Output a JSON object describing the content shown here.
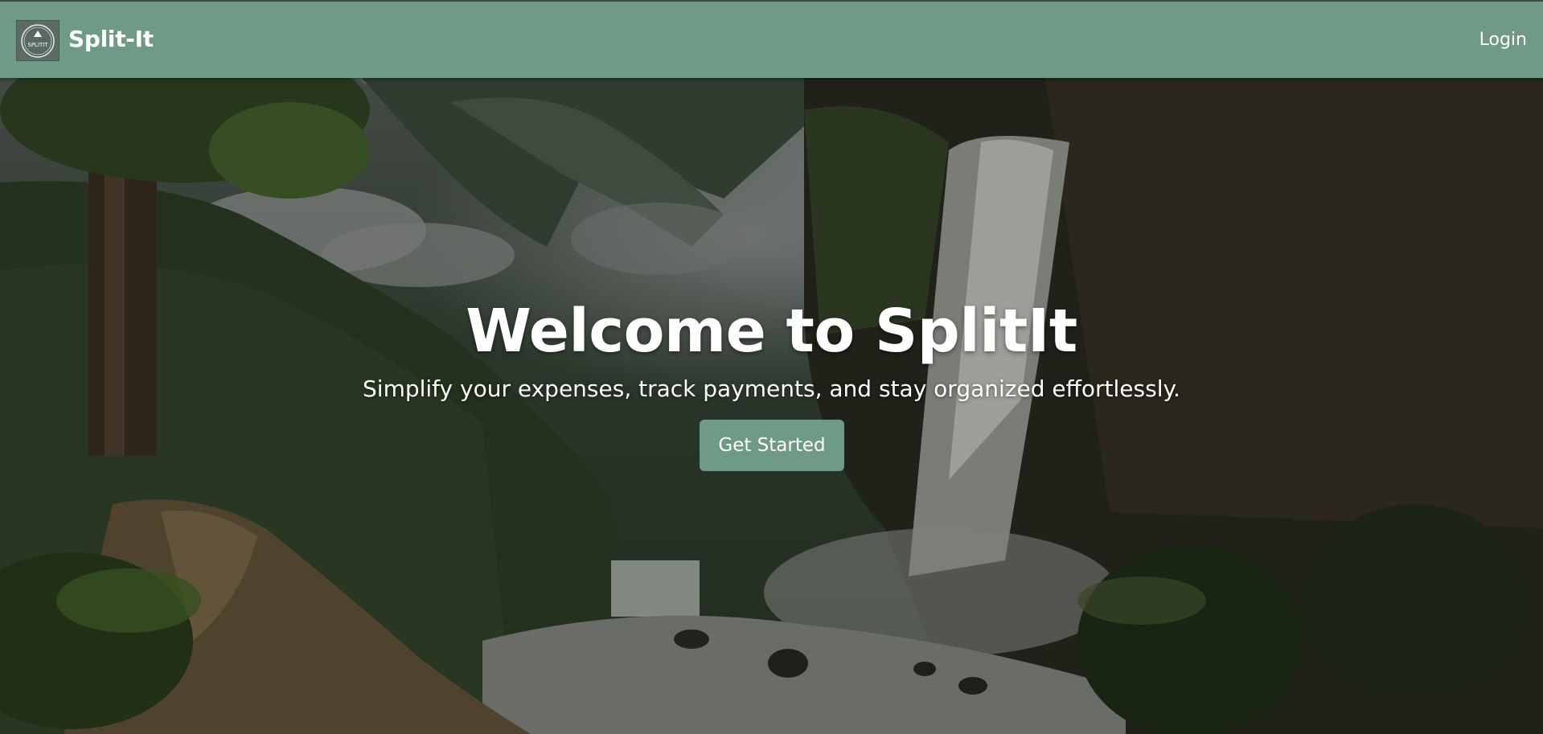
{
  "navbar": {
    "logo_text": "SPLITIT",
    "brand": "Split-It",
    "login_label": "Login"
  },
  "hero": {
    "title": "Welcome to SplitIt",
    "subtitle": "Simplify your expenses, track payments, and stay organized effortlessly.",
    "cta_label": "Get Started"
  },
  "colors": {
    "accent": "#6f9a87",
    "text": "#ffffff"
  },
  "icons": {
    "logo": "splitit-logo-icon"
  }
}
